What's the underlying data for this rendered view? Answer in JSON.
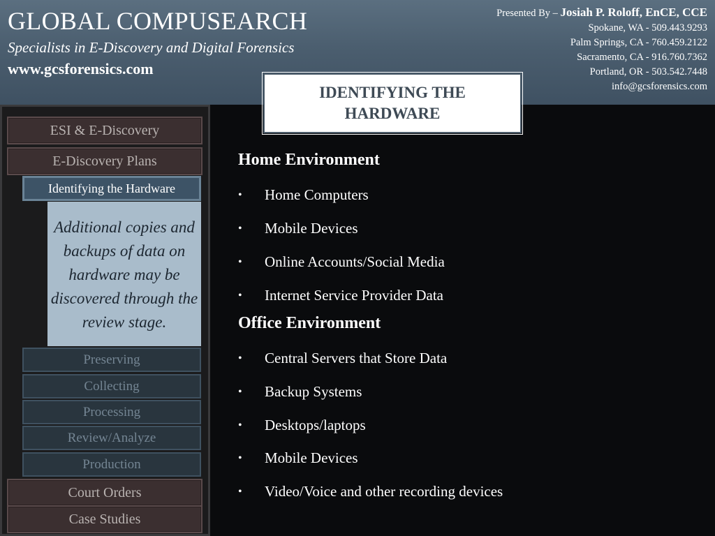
{
  "header": {
    "title": "GLOBAL COMPUSEARCH",
    "tagline": "Specialists in E-Discovery and Digital Forensics",
    "url": "www.gcsforensics.com",
    "presented_by_label": "Presented By – ",
    "presenter": "Josiah P. Roloff, EnCE, CCE",
    "locations": [
      "Spokane, WA - 509.443.9293",
      "Palm Springs, CA - 760.459.2122",
      "Sacramento, CA - 916.760.7362",
      "Portland, OR - 503.542.7448"
    ],
    "email": "info@gcsforensics.com"
  },
  "slide_title": "IDENTIFYING THE HARDWARE",
  "sidebar": {
    "main_items": [
      "ESI & E-Discovery",
      "E-Discovery Plans"
    ],
    "current_item": "Identifying the Hardware",
    "note": "Additional copies and backups of  data on hardware may be discovered  through the review stage.",
    "sub_items": [
      "Preserving",
      "Collecting",
      "Processing",
      "Review/Analyze",
      "Production"
    ],
    "bottom_items": [
      "Court Orders",
      "Case Studies"
    ]
  },
  "content": {
    "sections": [
      {
        "heading": "Home Environment",
        "bullets": [
          "Home Computers",
          "Mobile Devices",
          "Online Accounts/Social Media",
          "Internet Service Provider Data"
        ]
      },
      {
        "heading": "Office Environment",
        "bullets": [
          "Central Servers that Store Data",
          "Backup Systems",
          "Desktops/laptops",
          "Mobile Devices",
          "Video/Voice and other recording devices"
        ]
      }
    ],
    "bullet_glyph": "•"
  },
  "colors": {
    "header_bg": "#4b5e6f",
    "note_bg": "#a9bccb",
    "current_nav_bg": "#3d5366",
    "main_nav_bg": "#3b2f30"
  }
}
